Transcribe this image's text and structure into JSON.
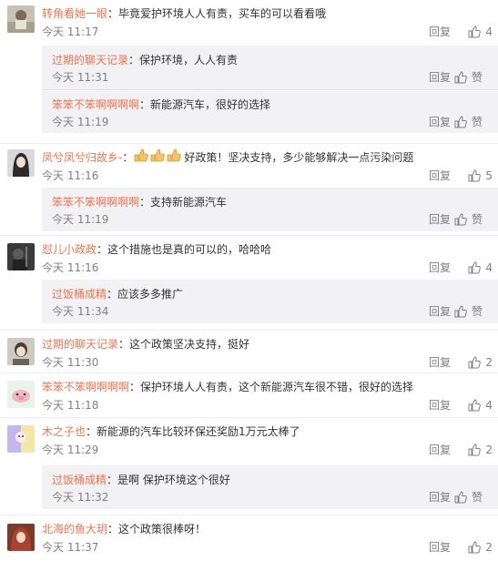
{
  "labels": {
    "reply": "回复",
    "like": "赞",
    "colon": "："
  },
  "colors": {
    "username": "#eb7350",
    "time": "#808080",
    "text": "#333333",
    "reply_bg": "#f2f2f5"
  },
  "comments": [
    {
      "user": "转角看她一眼",
      "text": "毕竟爱护环境人人有责，买车的可以看看哦",
      "time": "今天 11:17",
      "likes": "4",
      "replies": [
        {
          "user": "过期的聊天记录",
          "text": "保护环境，人人有责",
          "time": "今天 11:31"
        },
        {
          "user": "笨笨不笨啊啊啊啊",
          "text": "新能源汽车，很好的选择",
          "time": "今天 11:19"
        }
      ]
    },
    {
      "user": "凤兮凤兮归故乡-",
      "text": "好政策！坚决支持，多少能够解决一点污染问题",
      "time": "今天 11:16",
      "likes": "5",
      "replies": [
        {
          "user": "笨笨不笨啊啊啊啊",
          "text": "支持新能源汽车",
          "time": "今天 11:19"
        }
      ]
    },
    {
      "user": "怼儿小政政",
      "text": "这个措施也是真的可以的，哈哈哈",
      "time": "今天 11:16",
      "likes": "4",
      "replies": [
        {
          "user": "过饭桶成精",
          "text": "应该多多推广",
          "time": "今天 11:34"
        }
      ]
    },
    {
      "user": "过期的聊天记录",
      "text": "这个政策坚决支持，挺好",
      "time": "今天 11:30",
      "likes": "2",
      "replies": []
    },
    {
      "user": "笨笨不笨啊啊啊啊",
      "text": "保护环境人人有责，这个新能源汽车很不错，很好的选择",
      "time": "今天 11:18",
      "likes": "4",
      "replies": []
    },
    {
      "user": "木之子也",
      "text": "新能源的汽车比较环保还奖励1万元太棒了",
      "time": "今天 11:29",
      "likes": "2",
      "replies": [
        {
          "user": "过饭桶成精",
          "text": "是啊 保护环境这个很好",
          "time": "今天 11:32"
        }
      ]
    },
    {
      "user": "北海的鱼大玥",
      "text": "这个政策很棒呀！",
      "time": "今天 11:37",
      "likes": "2",
      "replies": []
    }
  ]
}
